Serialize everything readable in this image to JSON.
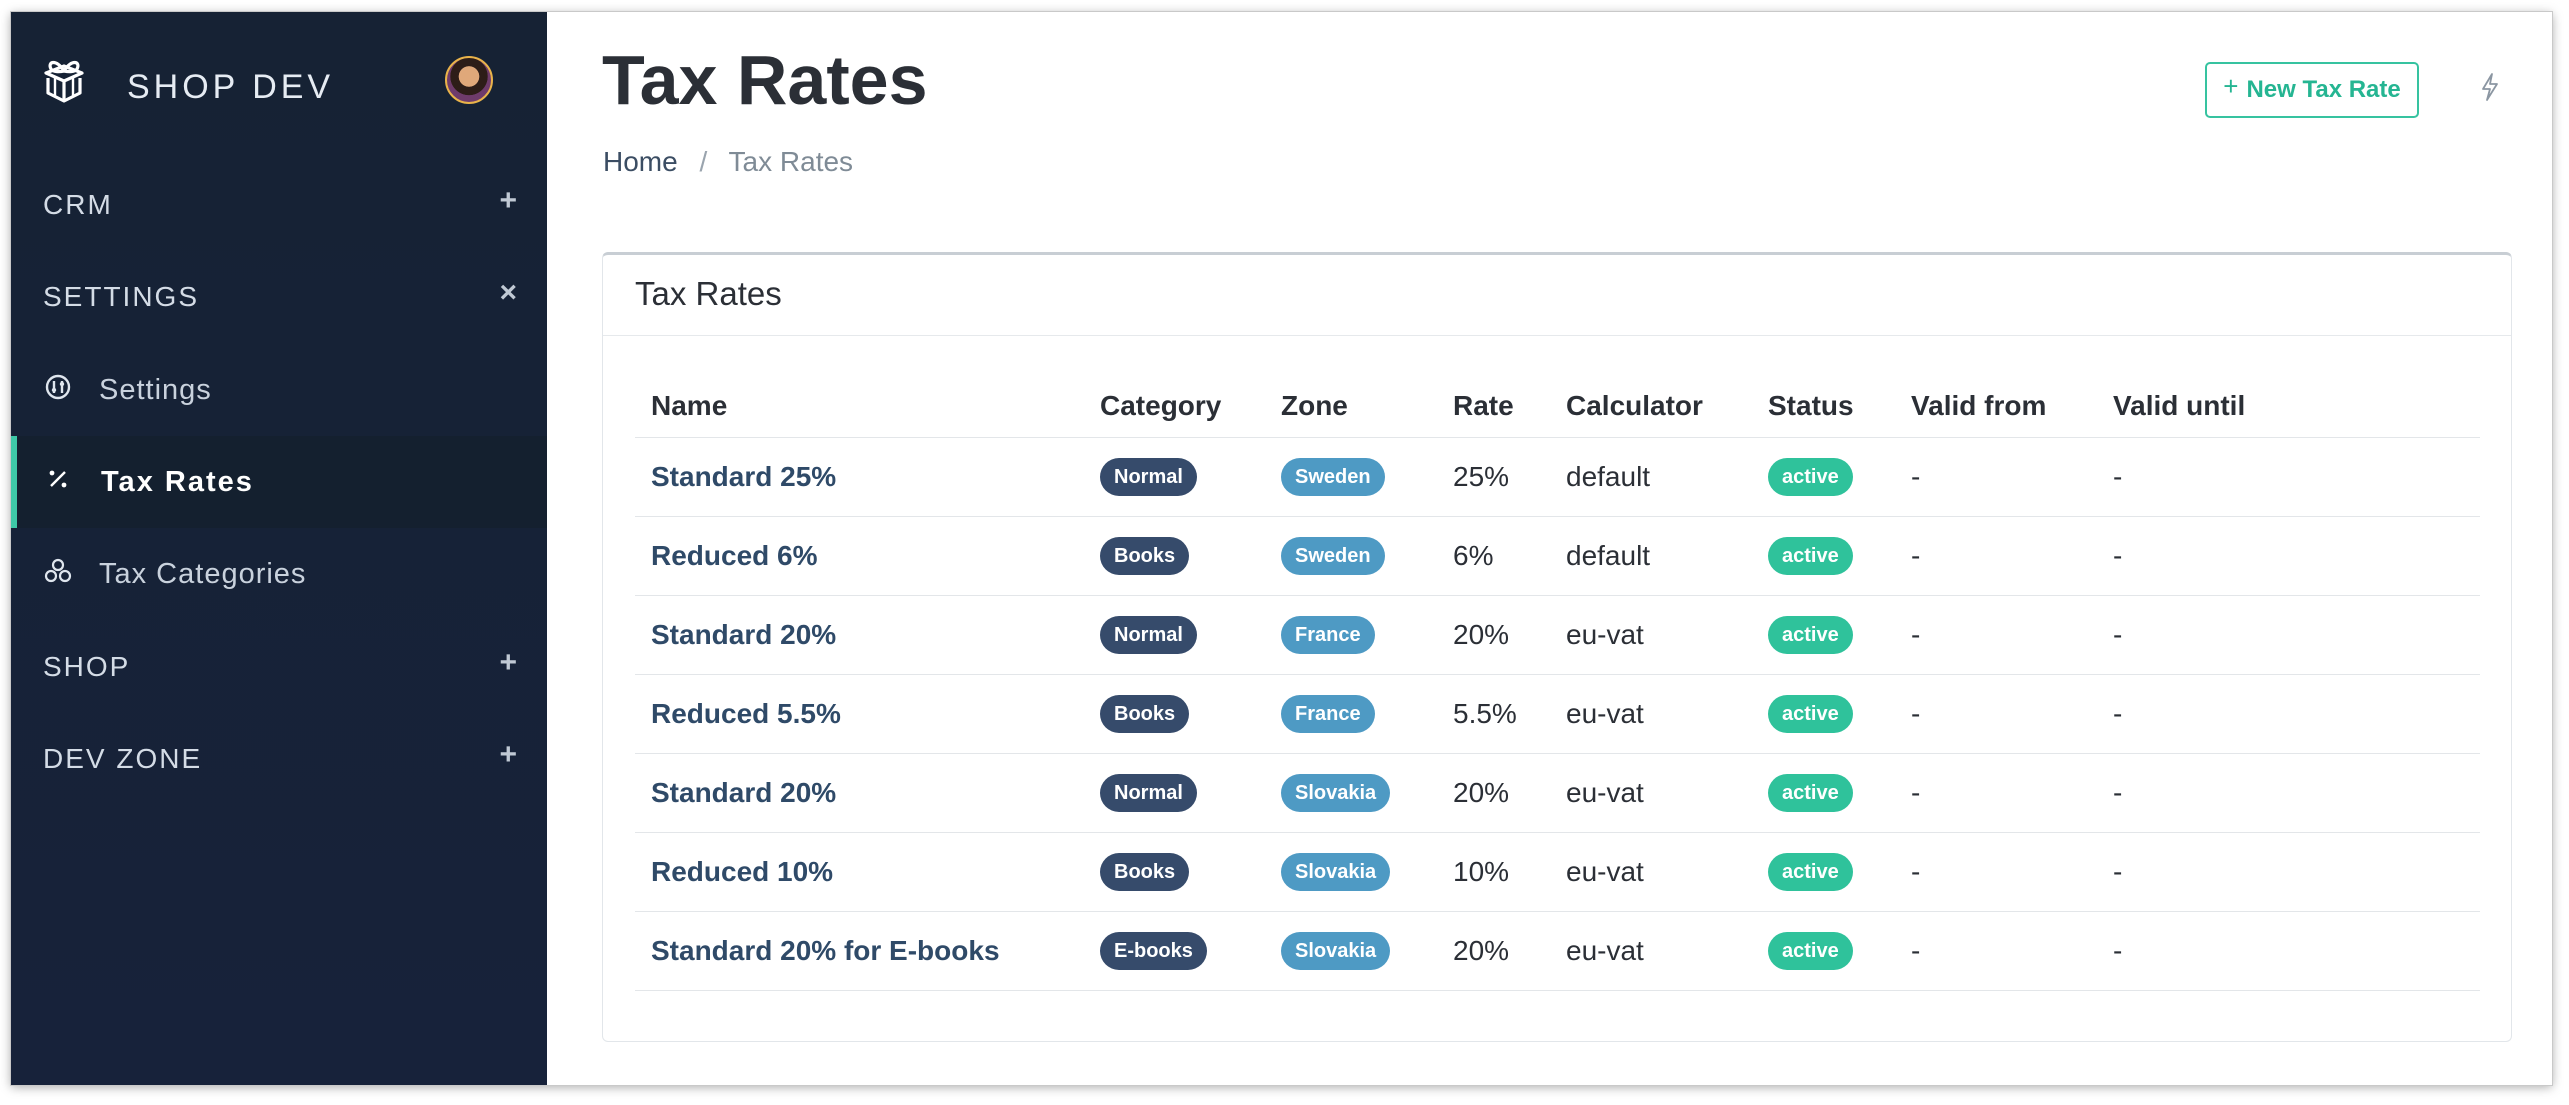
{
  "app": {
    "brand": "SHOP DEV"
  },
  "sidebar": {
    "sections": [
      {
        "label": "CRM",
        "toggle": "+"
      },
      {
        "label": "SETTINGS",
        "toggle": "×"
      },
      {
        "label": "SHOP",
        "toggle": "+"
      },
      {
        "label": "DEV ZONE",
        "toggle": "+"
      }
    ],
    "items": [
      {
        "label": "Settings",
        "icon": "settings-dial-icon"
      },
      {
        "label": "Tax Rates",
        "icon": "percent-icon",
        "active": true
      },
      {
        "label": "Tax Categories",
        "icon": "categories-icon"
      }
    ],
    "accent_color": "#3ec9a7"
  },
  "page": {
    "title": "Tax Rates",
    "breadcrumb": {
      "home": "Home",
      "separator": "/",
      "current": "Tax Rates"
    },
    "new_button": {
      "icon": "+",
      "label": "New Tax Rate"
    },
    "bolt_icon": "lightning-icon"
  },
  "card": {
    "title": "Tax Rates",
    "columns": [
      "Name",
      "Category",
      "Zone",
      "Rate",
      "Calculator",
      "Status",
      "Valid from",
      "Valid until"
    ],
    "rows": [
      {
        "name": "Standard 25%",
        "category": "Normal",
        "zone": "Sweden",
        "rate": "25%",
        "calculator": "default",
        "status": "active",
        "valid_from": "-",
        "valid_until": "-"
      },
      {
        "name": "Reduced 6%",
        "category": "Books",
        "zone": "Sweden",
        "rate": "6%",
        "calculator": "default",
        "status": "active",
        "valid_from": "-",
        "valid_until": "-"
      },
      {
        "name": "Standard 20%",
        "category": "Normal",
        "zone": "France",
        "rate": "20%",
        "calculator": "eu-vat",
        "status": "active",
        "valid_from": "-",
        "valid_until": "-"
      },
      {
        "name": "Reduced 5.5%",
        "category": "Books",
        "zone": "France",
        "rate": "5.5%",
        "calculator": "eu-vat",
        "status": "active",
        "valid_from": "-",
        "valid_until": "-"
      },
      {
        "name": "Standard 20%",
        "category": "Normal",
        "zone": "Slovakia",
        "rate": "20%",
        "calculator": "eu-vat",
        "status": "active",
        "valid_from": "-",
        "valid_until": "-"
      },
      {
        "name": "Reduced 10%",
        "category": "Books",
        "zone": "Slovakia",
        "rate": "10%",
        "calculator": "eu-vat",
        "status": "active",
        "valid_from": "-",
        "valid_until": "-"
      },
      {
        "name": "Standard 20% for E-books",
        "category": "E-books",
        "zone": "Slovakia",
        "rate": "20%",
        "calculator": "eu-vat",
        "status": "active",
        "valid_from": "-",
        "valid_until": "-"
      }
    ]
  },
  "colors": {
    "sidebar_bg": "#17223a",
    "category_badge": "#364b6b",
    "zone_badge": "#4e9ac4",
    "status_active": "#2fc29b",
    "primary_button": "#36c3a0"
  }
}
